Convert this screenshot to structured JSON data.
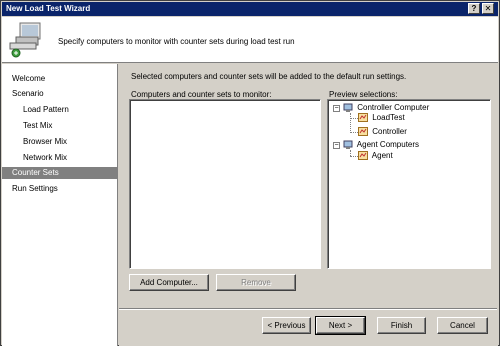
{
  "window": {
    "title": "New Load Test Wizard",
    "help_glyph": "?",
    "close_glyph": "✕"
  },
  "header": {
    "text": "Specify computers to monitor with counter sets during load test run"
  },
  "nav": {
    "items": [
      {
        "label": "Welcome"
      },
      {
        "label": "Scenario"
      },
      {
        "label": "Load Pattern"
      },
      {
        "label": "Test Mix"
      },
      {
        "label": "Browser Mix"
      },
      {
        "label": "Network Mix"
      },
      {
        "label": "Counter Sets"
      },
      {
        "label": "Run Settings"
      }
    ],
    "selected_index": 6
  },
  "main": {
    "instructions": "Selected computers and counter sets will be added to the default run settings.",
    "computers_label": "Computers and counter sets to monitor:",
    "preview_label": "Preview selections:",
    "tree": {
      "controller": "Controller Computer",
      "controller_children": [
        "LoadTest",
        "Controller"
      ],
      "agent": "Agent Computers",
      "agent_children": [
        "Agent"
      ]
    },
    "add_computer_label": "Add Computer...",
    "remove_label": "Remove"
  },
  "footer": {
    "previous_label": "< Previous",
    "next_label": "Next >",
    "finish_label": "Finish",
    "cancel_label": "Cancel"
  },
  "colors": {
    "titlebar": "#0a246a",
    "selection": "#808080",
    "face": "#d4d0c8"
  }
}
